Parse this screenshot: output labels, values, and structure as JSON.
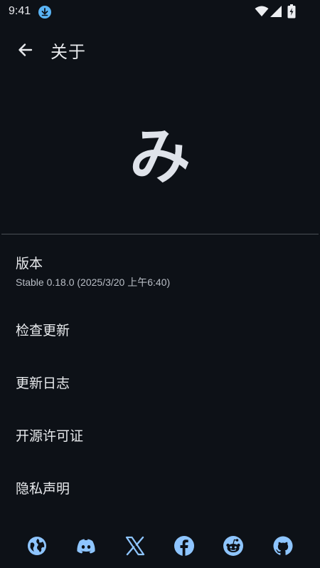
{
  "status_bar": {
    "time": "9:41",
    "icons": [
      "download-icon",
      "wifi-icon",
      "signal-icon",
      "battery-charging-icon"
    ]
  },
  "app_bar": {
    "title": "关于",
    "back_icon": "arrow-left-icon"
  },
  "logo": {
    "glyph": "み"
  },
  "list": [
    {
      "title": "版本",
      "subtitle": "Stable 0.18.0 (2025/3/20 上午6:40)"
    },
    {
      "title": "检查更新"
    },
    {
      "title": "更新日志"
    },
    {
      "title": "开源许可证"
    },
    {
      "title": "隐私声明"
    }
  ],
  "social_links": [
    "globe-icon",
    "discord-icon",
    "x-icon",
    "facebook-icon",
    "reddit-icon",
    "github-icon"
  ],
  "colors": {
    "background": "#0d1117",
    "text": "#e8eaed",
    "subtext": "#b9bec6",
    "accent": "#8ec5ff",
    "divider": "#4a5056",
    "download_badge": "#5ab4f5"
  }
}
